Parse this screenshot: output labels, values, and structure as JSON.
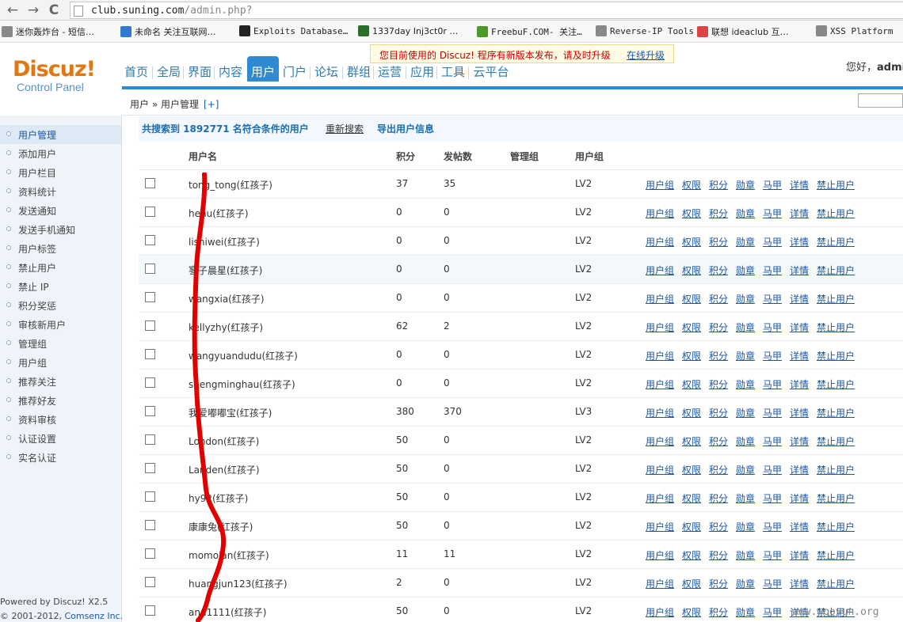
{
  "browser": {
    "url_host": "club.suning.com",
    "url_path": "/admin.php?",
    "back_icon": "←",
    "forward_icon": "→",
    "reload_icon": "C",
    "bookmarks": [
      {
        "label": "迷你轰炸台 - 短信…",
        "color": "#888"
      },
      {
        "label": "未命名 关注互联网…",
        "color": "#2f7ad2"
      },
      {
        "label": "Exploits Database…",
        "color": "#222"
      },
      {
        "label": "1337day Inj3ct0r …",
        "color": "#2a6e2a"
      },
      {
        "label": "FreebuF.COM- 关注…",
        "color": "#4a9a2a"
      },
      {
        "label": "Reverse-IP Tools",
        "color": "#888"
      },
      {
        "label": "联想 ideaclub 互…",
        "color": "#d44"
      },
      {
        "label": "XSS Platform",
        "color": "#888"
      }
    ]
  },
  "header": {
    "logo_main": "Discuz!",
    "logo_sub": "Control Panel",
    "nav": [
      "首页",
      "全局",
      "界面",
      "内容",
      "用户",
      "门户",
      "论坛",
      "群组",
      "运营",
      "应用",
      "工具",
      "云平台"
    ],
    "active_nav": "用户",
    "notice_text": "您目前使用的 Discuz! 程序有新版本发布，请及时升级",
    "notice_link": "在线升级",
    "hello_text": "您好，",
    "hello_user": "admin"
  },
  "breadcrumb": {
    "path": "用户 » 用户管理",
    "add": "[+]"
  },
  "sidebar": {
    "items": [
      "用户管理",
      "添加用户",
      "用户栏目",
      "资料统计",
      "发送通知",
      "发送手机通知",
      "用户标签",
      "禁止用户",
      "禁止 IP",
      "积分奖惩",
      "审核新用户",
      "管理组",
      "用户组",
      "推荐关注",
      "推荐好友",
      "资料审核",
      "认证设置",
      "实名认证"
    ],
    "active": "用户管理",
    "footer_line1": "Powered by Discuz! X2.5",
    "footer_line2_prefix": "© 2001-2012, ",
    "footer_line2_company": "Comsenz Inc."
  },
  "summary": {
    "text": "共搜索到 1892771 名符合条件的用户",
    "research": "重新搜索",
    "export": "导出用户信息"
  },
  "table": {
    "headers": [
      "用户名",
      "积分",
      "发帖数",
      "管理组",
      "用户组"
    ],
    "actions": [
      "用户组",
      "权限",
      "积分",
      "勋章",
      "马甲",
      "详情",
      "禁止用户"
    ],
    "rows": [
      {
        "username": "tong_tong(红孩子)",
        "credits": "37",
        "posts": "35",
        "admin_group": "",
        "user_group": "LV2"
      },
      {
        "username": "hehu(红孩子)",
        "credits": "0",
        "posts": "0",
        "admin_group": "",
        "user_group": "LV2"
      },
      {
        "username": "lishiwei(红孩子)",
        "credits": "0",
        "posts": "0",
        "admin_group": "",
        "user_group": "LV2"
      },
      {
        "username": "寥子晨星(红孩子)",
        "credits": "0",
        "posts": "0",
        "admin_group": "",
        "user_group": "LV2"
      },
      {
        "username": "wangxia(红孩子)",
        "credits": "0",
        "posts": "0",
        "admin_group": "",
        "user_group": "LV2"
      },
      {
        "username": "kellyzhy(红孩子)",
        "credits": "62",
        "posts": "2",
        "admin_group": "",
        "user_group": "LV2"
      },
      {
        "username": "wangyuandudu(红孩子)",
        "credits": "0",
        "posts": "0",
        "admin_group": "",
        "user_group": "LV2"
      },
      {
        "username": "shengminghau(红孩子)",
        "credits": "0",
        "posts": "0",
        "admin_group": "",
        "user_group": "LV2"
      },
      {
        "username": "我爱嘟嘟宝(红孩子)",
        "credits": "380",
        "posts": "370",
        "admin_group": "",
        "user_group": "LV3"
      },
      {
        "username": "London(红孩子)",
        "credits": "50",
        "posts": "0",
        "admin_group": "",
        "user_group": "LV2"
      },
      {
        "username": "Landen(红孩子)",
        "credits": "50",
        "posts": "0",
        "admin_group": "",
        "user_group": "LV2"
      },
      {
        "username": "hy92(红孩子)",
        "credits": "50",
        "posts": "0",
        "admin_group": "",
        "user_group": "LV2"
      },
      {
        "username": "康康兔(红孩子)",
        "credits": "50",
        "posts": "0",
        "admin_group": "",
        "user_group": "LV2"
      },
      {
        "username": "momolan(红孩子)",
        "credits": "11",
        "posts": "11",
        "admin_group": "",
        "user_group": "LV2"
      },
      {
        "username": "huangjun123(红孩子)",
        "credits": "2",
        "posts": "0",
        "admin_group": "",
        "user_group": "LV2"
      },
      {
        "username": "ann1111(红孩子)",
        "credits": "50",
        "posts": "0",
        "admin_group": "",
        "user_group": "LV2"
      }
    ]
  },
  "watermark": "www.wooyun.org",
  "colors": {
    "accent": "#2f8ad2",
    "link": "#1a57a8",
    "redaction": "#e00000"
  }
}
